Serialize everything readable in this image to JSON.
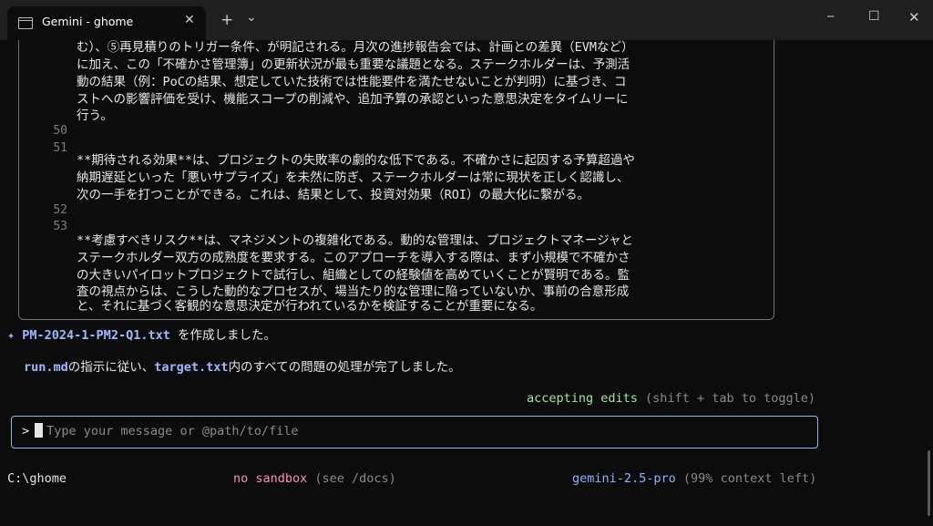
{
  "window": {
    "tab_title": "Gemini - ghome",
    "tab_close": "✕",
    "new_tab": "+",
    "dropdown": "⌄",
    "minimize": "─",
    "maximize": "☐",
    "close": "✕"
  },
  "document": {
    "continuation_lines": [
      "む）、⑤再見積りのトリガー条件、が明記される。月次の進捗報告会では、計画との差異（EVMなど）",
      "に加え、この「不確かさ管理簿」の更新状況が最も重要な議題となる。ステークホルダーは、予測活",
      "動の結果（例：PoCの結果、想定していた技術では性能要件を満たせないことが判明）に基づき、コ",
      "ストへの影響評価を受け、機能スコープの削減や、追加予算の承認といった意思決定をタイムリーに",
      "行う。"
    ],
    "blocks": [
      {
        "number": "50",
        "lines": []
      },
      {
        "number": "51",
        "lines": [
          "**期待される効果**は、プロジェクトの失敗率の劇的な低下である。不確かさに起因する予算超過や",
          "納期遅延といった「悪いサプライズ」を未然に防ぎ、ステークホルダーは常に現状を正しく認識し、",
          "次の一手を打つことができる。これは、結果として、投資対効果（ROI）の最大化に繋がる。"
        ]
      },
      {
        "number": "52",
        "lines": []
      },
      {
        "number": "53",
        "lines": [
          "**考慮すべきリスク**は、マネジメントの複雑化である。動的な管理は、プロジェクトマネージャと",
          "ステークホルダー双方の成熟度を要求する。このアプローチを導入する際は、まず小規模で不確かさ",
          "の大きいパイロットプロジェクトで試行し、組織としての経験値を高めていくことが賢明である。監",
          "査の視点からは、こうした動的なプロセスが、場当たり的な管理に陥っていないか、事前の合意形成",
          "と、それに基づく客観的な意思決定が行われているかを検証することが重要になる。"
        ]
      }
    ]
  },
  "status_messages": {
    "sparkle_icon": "✦",
    "created_file": "PM-2024-1-PM2-Q1.txt",
    "created_suffix": " を作成しました。",
    "complete_part1": "run.md",
    "complete_part2": "の指示に従い、",
    "complete_part3": "target.txt",
    "complete_part4": "内のすべての問題の処理が完了しました。"
  },
  "mode": {
    "label": "accepting edits",
    "hint": " (shift + tab to toggle)"
  },
  "input": {
    "prompt": ">",
    "placeholder": "Type your message or @path/to/file"
  },
  "footer": {
    "cwd": "C:\\ghome",
    "sandbox": "no sandbox",
    "sandbox_hint": " (see /docs)",
    "model": "gemini-2.5-pro",
    "context": " (99% context left)"
  },
  "colors": {
    "accent": "#9fb9ff",
    "sparkle": "#c88cff",
    "mode": "#9fe6a0",
    "sandbox": "#ff8fb0",
    "input_border": "#93b4f5"
  }
}
